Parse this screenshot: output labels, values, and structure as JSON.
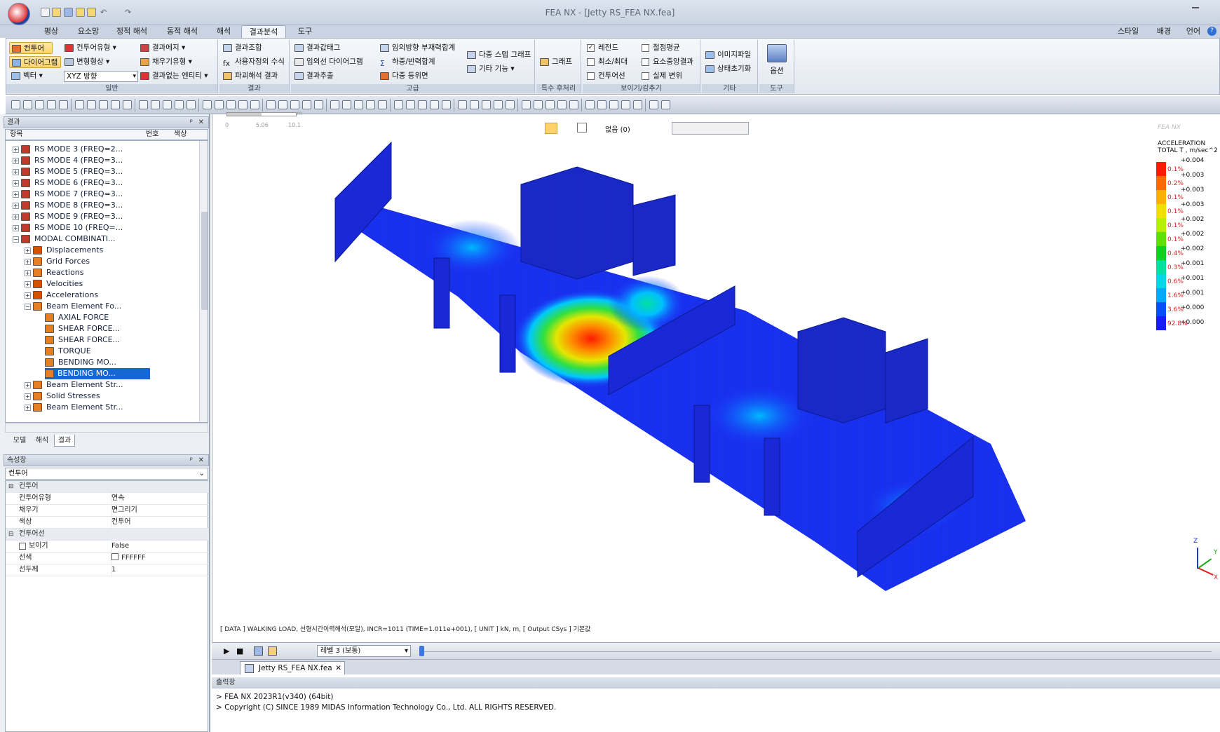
{
  "window": {
    "title": "FEA NX - [Jetty RS_FEA NX.fea]"
  },
  "ribbon_tabs": [
    "평상",
    "요소망",
    "정적 해석",
    "동적 해석",
    "해석",
    "결과분석",
    "도구"
  ],
  "ribbon_right": {
    "style": "스타일",
    "background": "배경",
    "language": "언어"
  },
  "groups": {
    "general": {
      "label": "일반",
      "contour": "컨투어",
      "contour_type": "컨투어유형",
      "result_edge": "결과에지",
      "diagram": "다이어그램",
      "deformed": "변형형상",
      "fill_type": "채우기유형",
      "vector": "벡터",
      "direction": "XYZ 방향",
      "no_result_entity": "결과없는 엔티티"
    },
    "result": {
      "label": "결과",
      "combo": "결과조합",
      "user_formula": "사용자정의 수식",
      "wave": "파괴해석 결과"
    },
    "advanced": {
      "label": "고급",
      "tag": "결과값태그",
      "arbitrary_diagram": "임의선 다이어그램",
      "extract": "결과추출",
      "arbitrary_sum": "임의방향 부재력합계",
      "load_sum": "하중/반력합계",
      "multi_iso": "다중 등위면",
      "multi_step": "다중 스텝 그래프",
      "other": "기타 기능"
    },
    "special": {
      "label": "특수 후처리",
      "graph": "그래프"
    },
    "display": {
      "label": "보이기/감추기",
      "legend": "레전드",
      "node_avg": "절점평균",
      "minmax": "최소/최대",
      "elem_center": "요소중앙결과",
      "contour_line": "컨투어선",
      "real_disp": "실제 변위"
    },
    "misc": {
      "label": "기타",
      "image_file": "이미지파일",
      "reset": "상태초기화"
    },
    "tools": {
      "label": "도구",
      "options": "옵션"
    }
  },
  "result_panel": {
    "header": "결과",
    "columns": [
      "항목",
      "번호",
      "색상"
    ],
    "nodes": [
      {
        "label": "RS MODE 3 (FREQ=2...",
        "level": 2,
        "expander": "+",
        "color": "#c0392b"
      },
      {
        "label": "RS MODE 4 (FREQ=3...",
        "level": 2,
        "expander": "+",
        "color": "#c0392b"
      },
      {
        "label": "RS MODE 5 (FREQ=3...",
        "level": 2,
        "expander": "+",
        "color": "#c0392b"
      },
      {
        "label": "RS MODE 6 (FREQ=3...",
        "level": 2,
        "expander": "+",
        "color": "#c0392b"
      },
      {
        "label": "RS MODE 7 (FREQ=3...",
        "level": 2,
        "expander": "+",
        "color": "#c0392b"
      },
      {
        "label": "RS MODE 8 (FREQ=3...",
        "level": 2,
        "expander": "+",
        "color": "#c0392b"
      },
      {
        "label": "RS MODE 9 (FREQ=3...",
        "level": 2,
        "expander": "+",
        "color": "#c0392b"
      },
      {
        "label": "RS MODE 10 (FREQ=...",
        "level": 2,
        "expander": "+",
        "color": "#c0392b"
      },
      {
        "label": "MODAL COMBINATI...",
        "level": 2,
        "expander": "-",
        "color": "#c0392b"
      },
      {
        "label": "Displacements",
        "level": 3,
        "expander": "+",
        "color": "#d35400"
      },
      {
        "label": "Grid Forces",
        "level": 3,
        "expander": "+",
        "color": "#e67e22"
      },
      {
        "label": "Reactions",
        "level": 3,
        "expander": "+",
        "color": "#e67e22"
      },
      {
        "label": "Velocities",
        "level": 3,
        "expander": "+",
        "color": "#d35400"
      },
      {
        "label": "Accelerations",
        "level": 3,
        "expander": "+",
        "color": "#d35400"
      },
      {
        "label": "Beam Element Fo...",
        "level": 3,
        "expander": "-",
        "color": "#e67e22"
      },
      {
        "label": "AXIAL FORCE",
        "level": 4,
        "expander": "",
        "color": "#e67e22"
      },
      {
        "label": "SHEAR FORCE...",
        "level": 4,
        "expander": "",
        "color": "#e67e22"
      },
      {
        "label": "SHEAR FORCE...",
        "level": 4,
        "expander": "",
        "color": "#e67e22"
      },
      {
        "label": "TORQUE",
        "level": 4,
        "expander": "",
        "color": "#e67e22"
      },
      {
        "label": "BENDING MO...",
        "level": 4,
        "expander": "",
        "color": "#e67e22"
      },
      {
        "label": "BENDING MO...",
        "level": 4,
        "expander": "",
        "color": "#e67e22",
        "selected": true
      },
      {
        "label": "Beam Element Str...",
        "level": 3,
        "expander": "+",
        "color": "#e67e22"
      },
      {
        "label": "Solid Stresses",
        "level": 3,
        "expander": "+",
        "color": "#e67e22"
      },
      {
        "label": "Beam Element Str...",
        "level": 3,
        "expander": "+",
        "color": "#e67e22"
      }
    ],
    "tabs": [
      "모델",
      "해석",
      "결과"
    ],
    "active_tab": "결과"
  },
  "property_panel": {
    "header": "속성창",
    "selector": "컨투어",
    "rows": [
      {
        "type": "cat",
        "key": "컨투어"
      },
      {
        "type": "row",
        "key": "컨투어유형",
        "value": "연속"
      },
      {
        "type": "row",
        "key": "채우기",
        "value": "면그리기"
      },
      {
        "type": "row",
        "key": "색상",
        "value": "컨투어"
      },
      {
        "type": "cat",
        "key": "컨투어선"
      },
      {
        "type": "row",
        "key": "보이기",
        "value": "False",
        "checkbox": true
      },
      {
        "type": "row",
        "key": "선색",
        "value": "FFFFFF",
        "swatch": true
      },
      {
        "type": "row",
        "key": "선두께",
        "value": "1"
      }
    ]
  },
  "viewport": {
    "scale_bar": {
      "unit": "m",
      "ticks": [
        "0",
        "5.06",
        "10.1"
      ]
    },
    "toolbar": {
      "none_label": "없음 (0)"
    },
    "watermark": "FEA NX",
    "legend": {
      "title_line1": "ACCELERATION",
      "title_line2": "TOTAL T , m/sec^2",
      "values": [
        "+0.004",
        "+0.003",
        "+0.003",
        "+0.003",
        "+0.002",
        "+0.002",
        "+0.002",
        "+0.001",
        "+0.001",
        "+0.001",
        "+0.000",
        "+0.000"
      ],
      "percents": [
        "0.1%",
        "0.2%",
        "0.1%",
        "0.1%",
        "0.1%",
        "0.1%",
        "0.4%",
        "0.3%",
        "0.6%",
        "1.6%",
        "3.6%",
        "92.8%"
      ],
      "colors": [
        "#ff1a00",
        "#ff6a00",
        "#ffb000",
        "#f0e000",
        "#b5f000",
        "#60e000",
        "#10d020",
        "#00e0a0",
        "#00d8e8",
        "#00a8ff",
        "#0050ff",
        "#1a1aff"
      ]
    },
    "status_info": "[ DATA ]  WALKING LOAD,  선형시간이력해석(모달),  INCR=1011 (TIME=1.011e+001),   [ UNIT ]   kN,  m,   [ Output CSys ]  기본값",
    "axes": {
      "x": "X",
      "y": "Y",
      "z": "Z"
    }
  },
  "animation_bar": {
    "level_select": "레벨 3 (보통)"
  },
  "document_tab": {
    "label": "Jetty RS_FEA NX.fea"
  },
  "output": {
    "header": "출력창",
    "lines": [
      "> FEA NX 2023R1(v340) (64bit)",
      "> Copyright (C) SINCE 1989 MIDAS Information Technology Co., Ltd. ALL RIGHTS RESERVED."
    ]
  }
}
